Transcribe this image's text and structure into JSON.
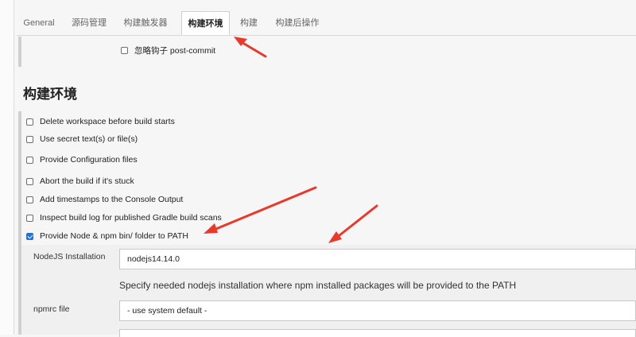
{
  "tabs": [
    {
      "label": "General"
    },
    {
      "label": "源码管理"
    },
    {
      "label": "构建触发器"
    },
    {
      "label": "构建环境"
    },
    {
      "label": "构建"
    },
    {
      "label": "构建后操作"
    }
  ],
  "active_tab": "构建环境",
  "trigger_options": {
    "ignore_post_commit": {
      "label": "忽略钩子 post-commit",
      "checked": false
    }
  },
  "section": {
    "title": "构建环境"
  },
  "build_env_options": [
    {
      "label": "Delete workspace before build starts",
      "checked": false
    },
    {
      "label": "Use secret text(s) or file(s)",
      "checked": false
    },
    {
      "label": "Provide Configuration files",
      "checked": false
    },
    {
      "label": "Abort the build if it's stuck",
      "checked": false
    },
    {
      "label": "Add timestamps to the Console Output",
      "checked": false
    },
    {
      "label": "Inspect build log for published Gradle build scans",
      "checked": false
    },
    {
      "label": "Provide Node & npm bin/ folder to PATH",
      "checked": true
    }
  ],
  "nodejs": {
    "installation_label": "NodeJS Installation",
    "installation_value": "nodejs14.14.0",
    "help_text": "Specify needed nodejs installation where npm installed packages will be provided to the PATH",
    "npmrc_label": "npmrc file",
    "npmrc_value": "- use system default -"
  },
  "annotation_color": "#e8392b"
}
